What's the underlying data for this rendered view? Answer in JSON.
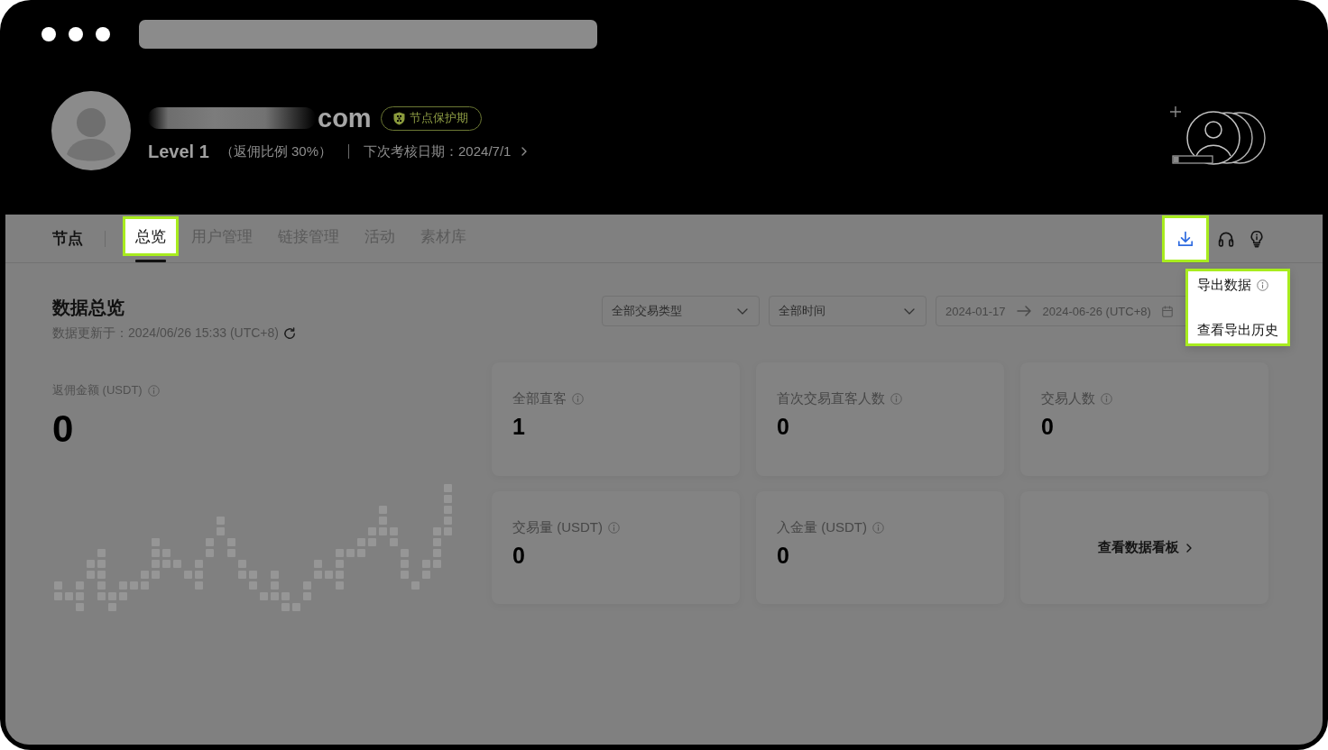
{
  "profile": {
    "email": "com",
    "email_blurred": true,
    "badge": "节点保护期",
    "level": "Level 1",
    "rebate_ratio": "（返佣比例 30%）",
    "next_review": "下次考核日期：2024/7/1"
  },
  "nav": {
    "section_title": "节点",
    "tabs": [
      {
        "label": "总览",
        "selected": true,
        "highlighted": true
      },
      {
        "label": "用户管理",
        "selected": false,
        "highlighted": false
      },
      {
        "label": "链接管理",
        "selected": false,
        "highlighted": false
      },
      {
        "label": "活动",
        "selected": false,
        "highlighted": false
      },
      {
        "label": "素材库",
        "selected": false,
        "highlighted": false
      }
    ],
    "toolbar": [
      {
        "kind": "download",
        "highlighted": true
      },
      {
        "kind": "headset",
        "highlighted": false
      },
      {
        "kind": "bulb",
        "highlighted": false
      }
    ],
    "export_menu": {
      "highlighted": true,
      "items": [
        {
          "label": "导出数据",
          "has_info": true
        },
        {
          "label": "查看导出历史",
          "has_info": false
        }
      ]
    }
  },
  "overview": {
    "title": "数据总览",
    "updated": "数据更新于：2024/06/26 15:33 (UTC+8)",
    "filters": [
      {
        "kind": "select",
        "value": "全部交易类型"
      },
      {
        "kind": "select",
        "value": "全部时间"
      },
      {
        "kind": "date_range",
        "start": "2024-01-17",
        "end": "2024-06-26 (UTC+8)"
      }
    ],
    "rebate": {
      "label": "返佣金额 (USDT)",
      "value": "0"
    },
    "cards": [
      {
        "kind": "stat",
        "label": "全部直客",
        "value": "1"
      },
      {
        "kind": "stat",
        "label": "首次交易直客人数",
        "value": "0"
      },
      {
        "kind": "stat",
        "label": "交易人数",
        "value": "0"
      },
      {
        "kind": "stat",
        "label": "交易量 (USDT)",
        "value": "0"
      },
      {
        "kind": "stat",
        "label": "入金量 (USDT)",
        "value": "0"
      },
      {
        "kind": "link",
        "label": "查看数据看板"
      }
    ]
  }
}
